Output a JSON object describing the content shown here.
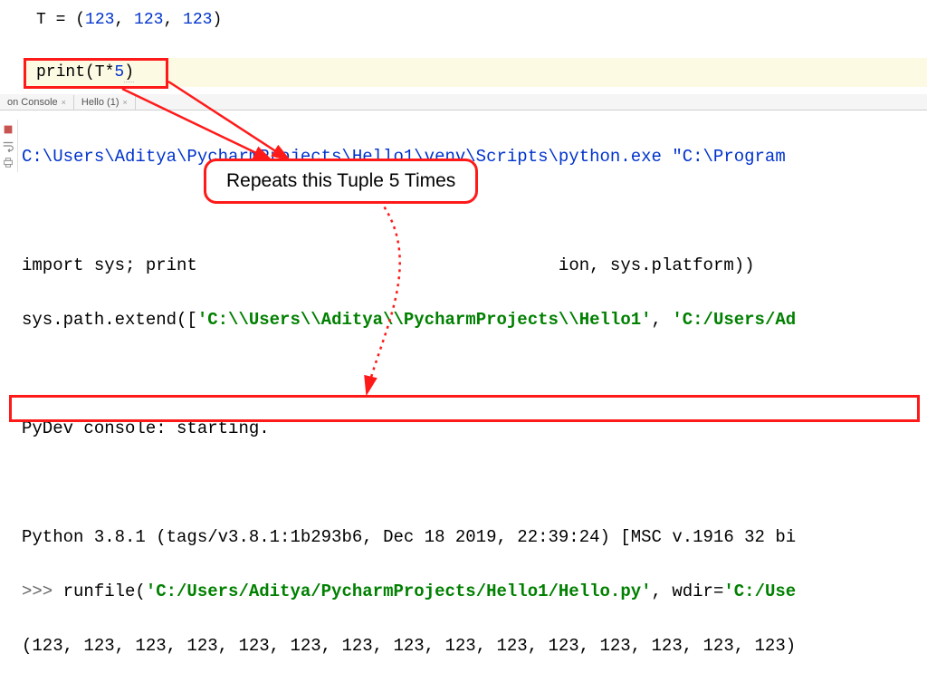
{
  "editor": {
    "line1_prefix": "T = (",
    "line1_n1": "123",
    "line1_sep": ", ",
    "line1_n2": "123",
    "line1_n3": "123",
    "line1_suffix": ")",
    "line2_prefix": "print(T*",
    "line2_n": "5",
    "line2_suffix": ")"
  },
  "tabs": {
    "console": "on Console",
    "hello": "Hello (1)",
    "close": "×"
  },
  "console": {
    "path_line": "C:\\Users\\Aditya\\PycharmProjects\\Hello1\\venv\\Scripts\\python.exe \"C:\\Program",
    "import_prefix": "import sys; print",
    "import_suffix": "ion, sys.platform))",
    "syspath_prefix": "sys.path.extend([",
    "syspath_str1": "'C:\\\\Users\\\\Aditya\\\\PycharmProjects\\\\Hello1'",
    "syspath_sep": ", ",
    "syspath_str2": "'C:/Users/Ad",
    "pydev": "PyDev console: starting.",
    "python_ver": "Python 3.8.1 (tags/v3.8.1:1b293b6, Dec 18 2019, 22:39:24) [MSC v.1916 32 bi",
    "prompt": ">>> ",
    "runfile_name": "runfile(",
    "runfile_str1": "'C:/Users/Aditya/PycharmProjects/Hello1/Hello.py'",
    "runfile_sep": ", wdir=",
    "runfile_str2": "'C:/Use",
    "output": "(123, 123, 123, 123, 123, 123, 123, 123, 123, 123, 123, 123, 123, 123, 123)"
  },
  "callout": {
    "text": "Repeats this Tuple 5 Times"
  }
}
